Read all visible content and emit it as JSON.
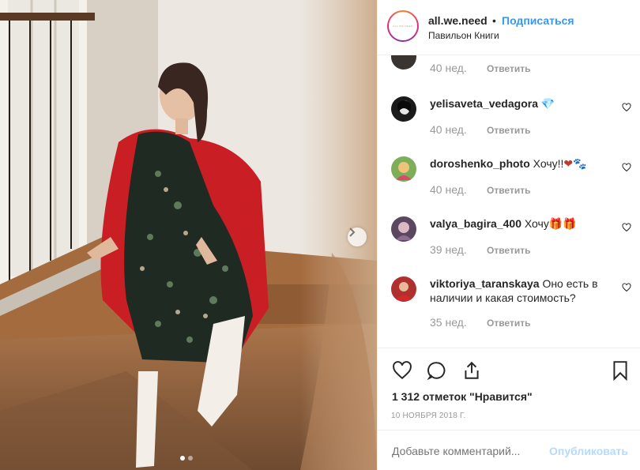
{
  "post": {
    "account": {
      "username": "all.we.need",
      "avatar_text": "ALL WE NEED",
      "separator": "•",
      "follow_label": "Подписаться",
      "location": "Павильон Книги"
    },
    "carousel": {
      "total": 2,
      "current": 1
    },
    "comments": [
      {
        "username": "",
        "text": "",
        "time": "40 нед.",
        "reply_label": "Ответить",
        "emoji": ""
      },
      {
        "username": "yelisaveta_vedagora",
        "text": "",
        "emoji": "💎",
        "time": "40 нед.",
        "reply_label": "Ответить"
      },
      {
        "username": "doroshenko_photo",
        "text": "Хочу!!",
        "emoji": "❤🐾",
        "time": "40 нед.",
        "reply_label": "Ответить"
      },
      {
        "username": "valya_bagira_400",
        "text": "Хочу",
        "emoji": "🎁🎁",
        "time": "39 нед.",
        "reply_label": "Ответить"
      },
      {
        "username": "viktoriya_taranskaya",
        "text": "Оно есть в наличии и какая стоимость?",
        "emoji": "",
        "time": "35 нед.",
        "reply_label": "Ответить"
      }
    ],
    "likes_text": "1 312 отметок \"Нравится\"",
    "date": "10 НОЯБРЯ 2018 Г.",
    "add_comment": {
      "placeholder": "Добавьте комментарий...",
      "post_label": "Опубликовать"
    },
    "icons": [
      "heart-icon",
      "comment-icon",
      "share-icon",
      "bookmark-icon",
      "chevron-right-icon"
    ],
    "colors": {
      "accent": "#3897f0",
      "muted": "#999999",
      "post_disabled": "#b3dbff",
      "coat": "#c81e24"
    }
  }
}
